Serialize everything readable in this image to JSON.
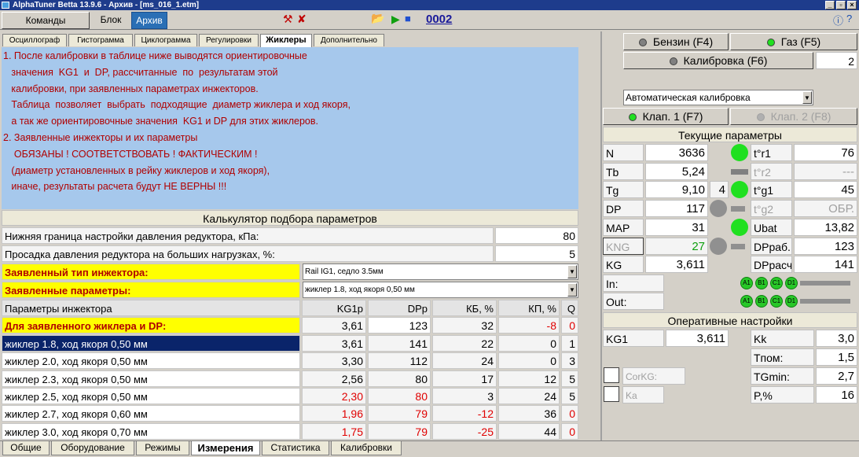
{
  "window": {
    "title": "AlphaTuner Betta 13.9.6 - Архив - [ms_016_1.etm]"
  },
  "toolbar": {
    "commands": "Команды",
    "block": "Блок",
    "archive": "Архив",
    "counter": "0002"
  },
  "tabs": [
    "Осциллограф",
    "Гистограмма",
    "Циклограмма",
    "Регулировки",
    "Жиклеры",
    "Дополнительно"
  ],
  "info_lines": [
    "1. После калибровки в таблице ниже выводятся ориентировочные",
    "   значения  KG1  и  DP, рассчитанные  по  результатам этой",
    "   калибровки, при заявленных параметрах инжекторов.",
    "   Таблица  позволяет  выбрать  подходящие  диаметр жиклера и ход якоря,",
    "   а так же ориентировочные значения  KG1 и DP для этих жиклеров.",
    "2. Заявленные инжекторы и их параметры",
    "    ОБЯЗАНЫ ! СООТВЕТСТВОВАТЬ ! ФАКТИЧЕСКИМ !",
    "   (диаметр установленных в рейку жиклеров и ход якоря),",
    "   иначе, результаты расчета будут НЕ ВЕРНЫ !!!"
  ],
  "calc": {
    "title": "Калькулятор подбора параметров",
    "lower_label": "Нижняя граница настройки давления редуктора, кПа:",
    "lower_value": "80",
    "drop_label": "Просадка давления редуктора на больших нагрузках, %:",
    "drop_value": "5",
    "injector_type_label": "Заявленный тип инжектора:",
    "injector_type_value": "Rail IG1,  седло 3.5мм",
    "params_label": "Заявленные параметры:",
    "params_value": "жиклер 1.8, ход якоря 0,50 мм"
  },
  "table": {
    "headers": [
      "Параметры инжектора",
      "KG1р",
      "DPр",
      "КБ, %",
      "КП, %",
      "Q"
    ],
    "declared": {
      "label": "Для заявленного жиклера и DP:",
      "kg": "3,61",
      "dp": "123",
      "kb": "32",
      "kp": "-8",
      "q": "0"
    },
    "rows": [
      {
        "label": "жиклер 1.8, ход якоря 0,50 мм",
        "kg": "3,61",
        "dp": "141",
        "kb": "22",
        "kp": "0",
        "q": "1"
      },
      {
        "label": "жиклер 2.0, ход якоря 0,50 мм",
        "kg": "3,30",
        "dp": "112",
        "kb": "24",
        "kp": "0",
        "q": "3"
      },
      {
        "label": "жиклер 2.3, ход якоря 0,50 мм",
        "kg": "2,56",
        "dp": "80",
        "kb": "17",
        "kp": "12",
        "q": "5"
      },
      {
        "label": "жиклер 2.5, ход якоря 0,50 мм",
        "kg": "2,30",
        "dp": "80",
        "kb": "3",
        "kp": "24",
        "q": "5"
      },
      {
        "label": "жиклер 2.7, ход якоря 0,60 мм",
        "kg": "1,96",
        "dp": "79",
        "kb": "-12",
        "kp": "36",
        "q": "0"
      },
      {
        "label": "жиклер 3.0, ход якоря 0,70 мм",
        "kg": "1,75",
        "dp": "79",
        "kb": "-25",
        "kp": "44",
        "q": "0"
      }
    ]
  },
  "bottom_tabs": [
    "Общие",
    "Оборудование",
    "Режимы",
    "Измерения",
    "Статистика",
    "Калибровки"
  ],
  "right": {
    "benzin": "Бензин (F4)",
    "gas": "Газ  (F5)",
    "calibration": "Калибровка  (F6)",
    "calib_num": "2",
    "mode": "Автоматическая калибровка",
    "valve1": "Клап. 1 (F7)",
    "valve2": "Клап. 2 (F8)",
    "current_title": "Текущие параметры",
    "params": [
      {
        "l": "N",
        "v": "3636",
        "rl": "t°r1",
        "rv": "76"
      },
      {
        "l": "Tb",
        "v": "5,24",
        "rl": "t°r2",
        "rv": "---"
      },
      {
        "l": "Tg",
        "v": "9,10",
        "extra": "4",
        "rl": "t°g1",
        "rv": "45"
      },
      {
        "l": "DP",
        "v": "117",
        "rl": "t°g2",
        "rv": "ОБР."
      },
      {
        "l": "MAP",
        "v": "31",
        "rl": "Ubat",
        "rv": "13,82"
      },
      {
        "l": "KNG",
        "v": "27",
        "rl": "DPраб.",
        "rv": "123"
      },
      {
        "l": "KG",
        "v": "3,611",
        "rl": "DPрасч",
        "rv": "141"
      }
    ],
    "in_label": "In:",
    "out_label": "Out:",
    "leds": [
      "A1",
      "B1",
      "C1",
      "D1"
    ],
    "op_title": "Оперативные настройки",
    "kg1_label": "KG1",
    "kg1_value": "3,611",
    "kk_label": "Kk",
    "kk_value": "3,0",
    "tpom_label": "Tпом:",
    "tpom_value": "1,5",
    "tgmin_label": "TGmin:",
    "tgmin_value": "2,7",
    "p_label": "P,%",
    "p_value": "16",
    "corkg_label": "CorKG:",
    "ka_label": "Ka"
  }
}
